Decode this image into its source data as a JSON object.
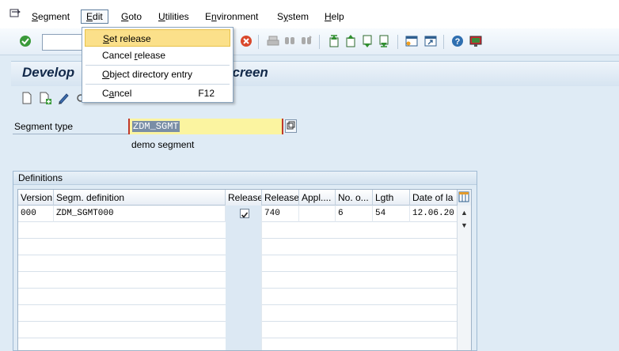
{
  "menubar": {
    "items": [
      {
        "label": "Segment",
        "u": "S",
        "rest": "egment"
      },
      {
        "label": "Edit",
        "u": "E",
        "rest": "dit"
      },
      {
        "label": "Goto",
        "u": "G",
        "rest": "oto"
      },
      {
        "label": "Utilities",
        "u": "U",
        "rest": "tilities"
      },
      {
        "label": "Environment",
        "u": "n",
        "pre": "E",
        "rest": "vironment"
      },
      {
        "label": "System",
        "u": "y",
        "pre": "S",
        "rest": "stem"
      },
      {
        "label": "Help",
        "u": "H",
        "rest": "elp"
      }
    ]
  },
  "toolbar": {
    "command_field_value": "",
    "icons": [
      "enter-icon",
      "cancel-icon",
      "print-icon",
      "find-icon",
      "find-next-icon",
      "first-page-icon",
      "previous-page-icon",
      "next-page-icon",
      "last-page-icon",
      "create-session-icon",
      "shortcut-icon",
      "help-icon",
      "customize-layout-icon"
    ]
  },
  "title": {
    "left": "Develop",
    "right": "screen"
  },
  "app_toolbar": {
    "icons": [
      "create-icon",
      "create-sub-icon",
      "change-icon",
      "display-icon"
    ]
  },
  "segment": {
    "label": "Segment type",
    "value": "ZDM_SGMT",
    "description": "demo segment"
  },
  "definitions": {
    "group_title": "Definitions",
    "columns": [
      "Version",
      "Segm. definition",
      "Release",
      "Release",
      "Appl....",
      "No. o...",
      "Lgth",
      "Date of la"
    ],
    "rows": [
      {
        "version": "000",
        "segm_definition": "ZDM_SGMT000",
        "release_flag": true,
        "release": "740",
        "appl": "",
        "no_of": "6",
        "lgth": "54",
        "date": "12.06.20"
      }
    ]
  },
  "edit_menu": {
    "items": [
      {
        "label": "Set release",
        "u": "S",
        "rest": "et release",
        "shortcut": "",
        "highlighted": true
      },
      {
        "label": "Cancel release",
        "pre": "Cancel ",
        "u": "r",
        "rest": "elease",
        "shortcut": ""
      },
      {
        "label": "Object directory entry",
        "u": "O",
        "rest": "bject directory entry",
        "shortcut": ""
      },
      {
        "label": "Cancel",
        "pre": "C",
        "u": "a",
        "rest": "ncel",
        "shortcut": "F12"
      }
    ]
  },
  "colors": {
    "background": "#dfebf5",
    "highlight": "#fbe08a",
    "input_required": "#fbf4a0"
  }
}
